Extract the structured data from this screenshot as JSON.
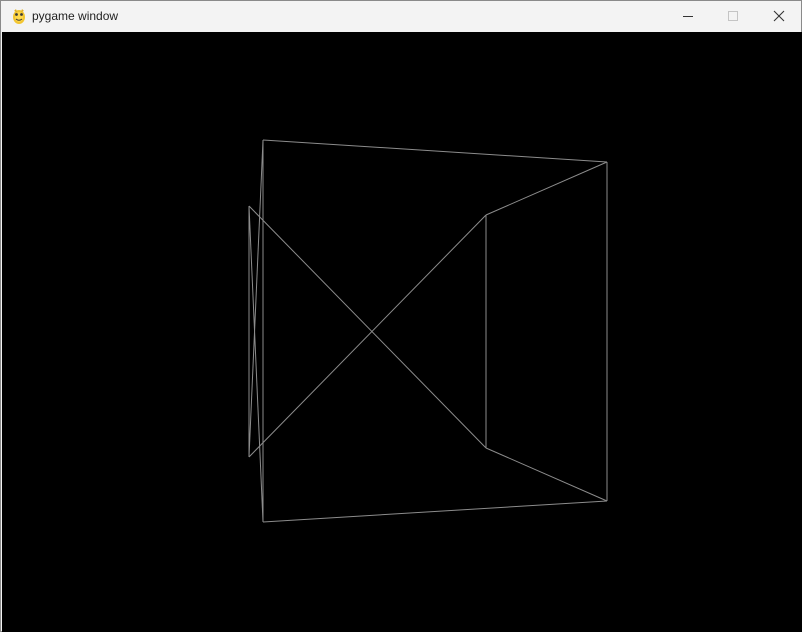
{
  "window": {
    "title": "pygame window",
    "icon": "pygame-snake-icon",
    "controls": [
      {
        "name": "minimize",
        "icon": "minimize-icon"
      },
      {
        "name": "maximize",
        "icon": "maximize-icon"
      },
      {
        "name": "close",
        "icon": "close-icon"
      }
    ]
  },
  "canvas": {
    "background": "#000000",
    "line_color": "#8c8c8c"
  }
}
